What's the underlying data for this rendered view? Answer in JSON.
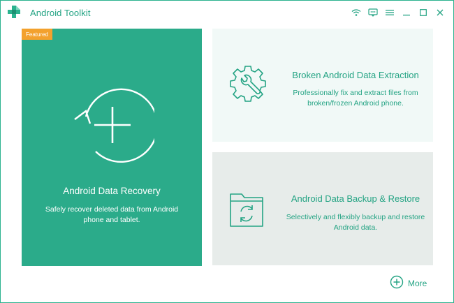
{
  "app": {
    "title": "Android Toolkit"
  },
  "titlebar": {
    "controls": [
      {
        "icon": "wifi-icon"
      },
      {
        "icon": "feedback-icon"
      },
      {
        "icon": "menu-icon"
      },
      {
        "icon": "minimize-icon"
      },
      {
        "icon": "maximize-icon"
      },
      {
        "icon": "close-icon"
      }
    ]
  },
  "cards": {
    "recovery": {
      "badge": "Featured",
      "title": "Android Data Recovery",
      "description": "Safely recover deleted data from Android phone and tablet.",
      "icon": "recover-plus-icon"
    },
    "extraction": {
      "title": "Broken Android Data Extraction",
      "description": "Professionally fix and extract files from broken/frozen Android phone.",
      "icon": "gear-wrench-icon"
    },
    "backup": {
      "title": "Android Data Backup & Restore",
      "description": "Selectively and flexibly backup and restore Android data.",
      "icon": "folder-sync-icon"
    }
  },
  "footer": {
    "more_label": "More"
  },
  "colors": {
    "accent": "#23a383",
    "primary_card": "#2bab8a",
    "badge": "#f3a12d",
    "card_light": "#f1f9f7",
    "card_grey": "#e7ecea"
  }
}
